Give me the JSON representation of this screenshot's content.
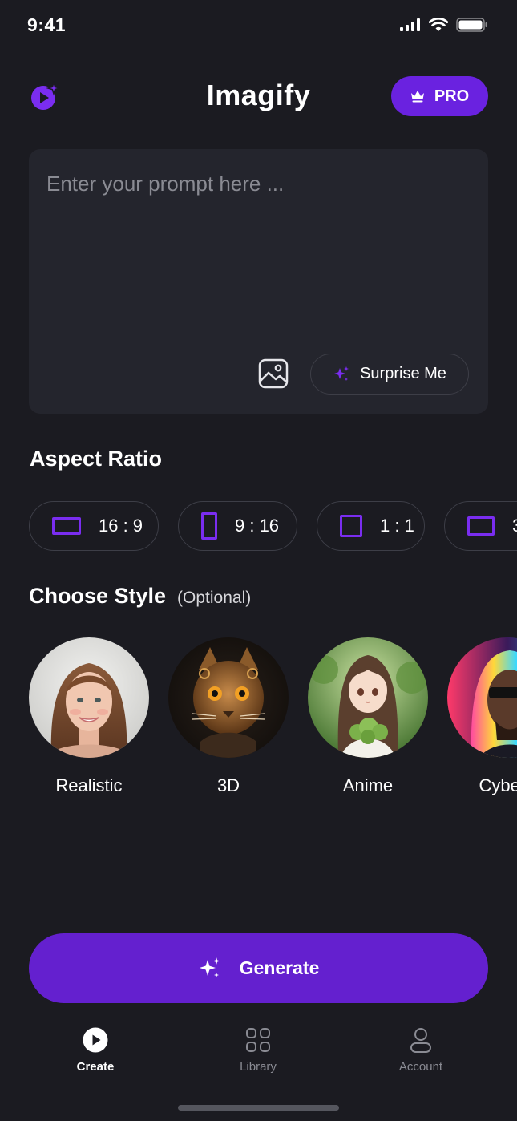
{
  "status_bar": {
    "time": "9:41",
    "icons": [
      "signal-icon",
      "wifi-icon",
      "battery-icon"
    ]
  },
  "header": {
    "title": "Imagify",
    "pro_label": "PRO",
    "logo_icon": "sparkle-play-logo-icon",
    "pro_icon": "crown-icon"
  },
  "prompt": {
    "placeholder": "Enter your prompt here ...",
    "value": "",
    "image_icon": "image-icon",
    "surprise_label": "Surprise Me",
    "surprise_icon": "sparkle-icon"
  },
  "aspect": {
    "title": "Aspect Ratio",
    "options": [
      {
        "label": "16 : 9",
        "icon": "landscape-ratio-icon"
      },
      {
        "label": "9 : 16",
        "icon": "portrait-ratio-icon"
      },
      {
        "label": "1 : 1",
        "icon": "square-ratio-icon"
      },
      {
        "label": "3",
        "icon": "landscape-ratio-icon"
      }
    ]
  },
  "style": {
    "title": "Choose Style",
    "optional": "(Optional)",
    "options": [
      {
        "label": "Realistic"
      },
      {
        "label": "3D"
      },
      {
        "label": "Anime"
      },
      {
        "label": "Cyberp"
      }
    ]
  },
  "generate": {
    "label": "Generate",
    "icon": "sparkle-icon"
  },
  "tabs": [
    {
      "label": "Create",
      "icon": "play-circle-icon",
      "active": true
    },
    {
      "label": "Library",
      "icon": "grid-icon",
      "active": false
    },
    {
      "label": "Account",
      "icon": "user-icon",
      "active": false
    }
  ],
  "colors": {
    "background": "#1b1b21",
    "accent": "#6a22e0",
    "card": "#24252d"
  }
}
